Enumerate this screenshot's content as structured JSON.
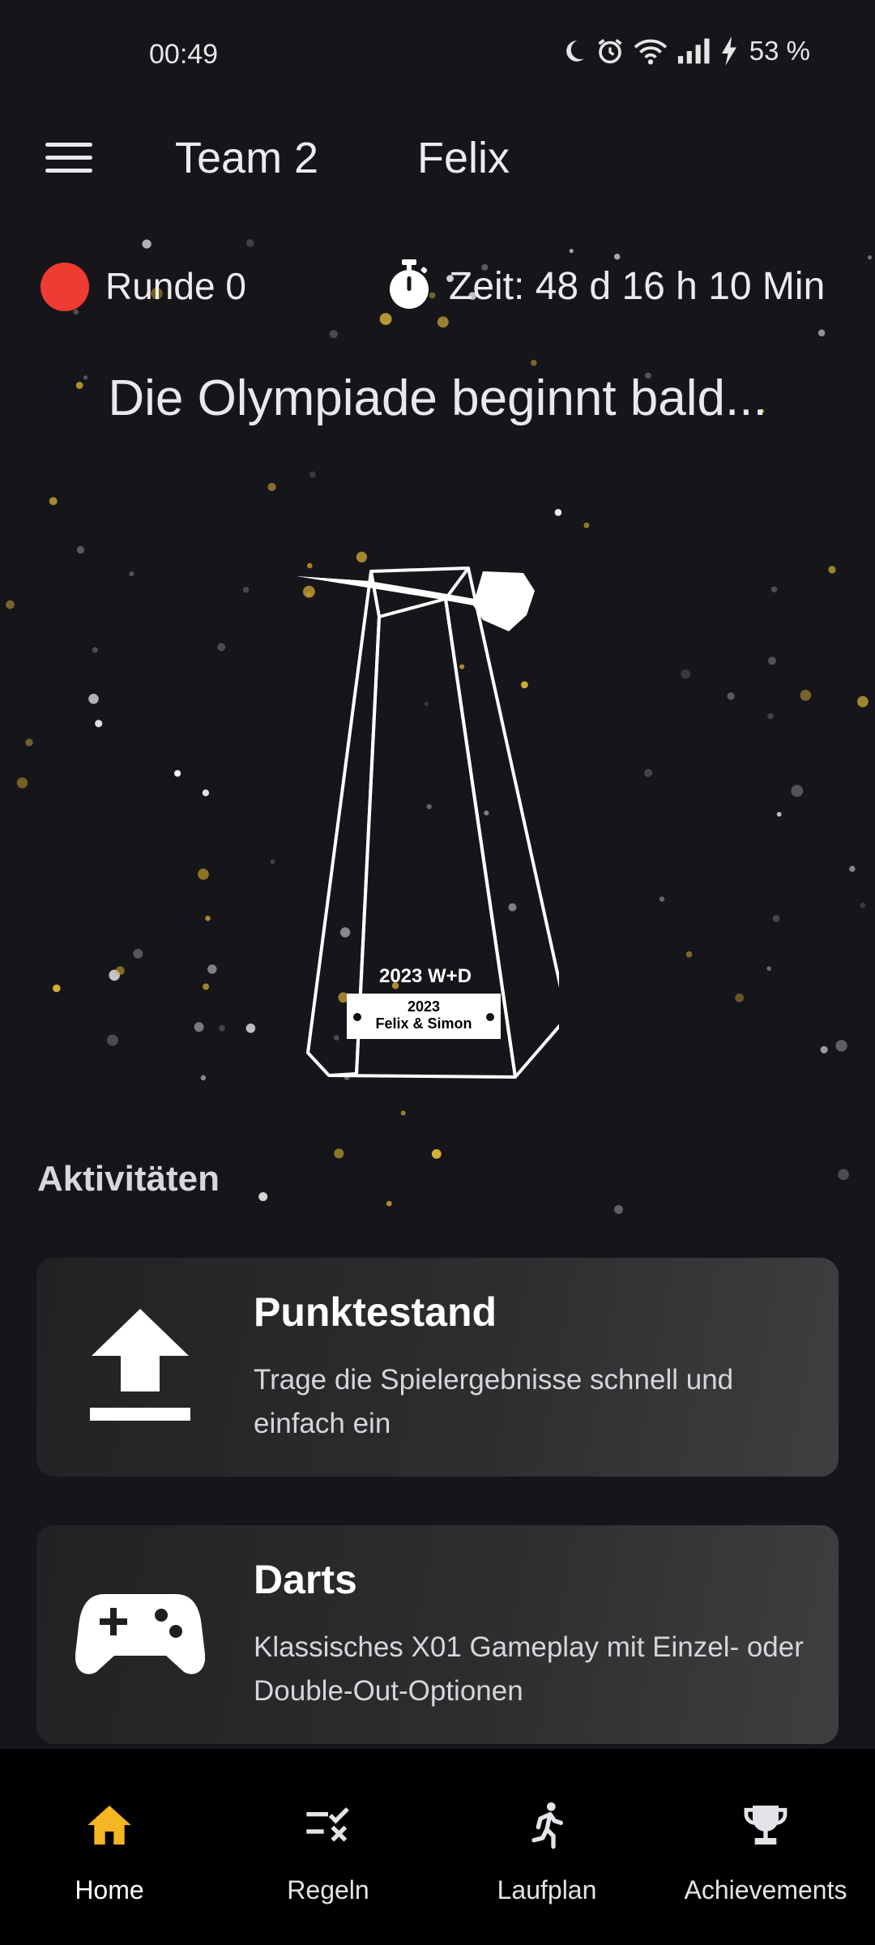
{
  "status_bar": {
    "time": "00:49",
    "battery": "53 %"
  },
  "top_bar": {
    "team": "Team 2",
    "player": "Felix"
  },
  "info": {
    "round": "Runde 0",
    "timer": "Zeit: 48 d 16 h 10 Min"
  },
  "headline": "Die Olympiade beginnt bald...",
  "trophy": {
    "title": "2023 W+D",
    "plaque_line1": "2023",
    "plaque_line2": "Felix & Simon"
  },
  "activities": {
    "title": "Aktivitäten",
    "cards": [
      {
        "icon": "upload-icon",
        "title": "Punktestand",
        "description": "Trage die Spielergebnisse schnell und einfach ein"
      },
      {
        "icon": "gamepad-icon",
        "title": "Darts",
        "description": "Klassisches X01 Gameplay mit Einzel- oder Double-Out-Optionen"
      }
    ]
  },
  "nav": [
    {
      "icon": "home-icon",
      "label": "Home",
      "active": true
    },
    {
      "icon": "rules-icon",
      "label": "Regeln",
      "active": false
    },
    {
      "icon": "runner-icon",
      "label": "Laufplan",
      "active": false
    },
    {
      "icon": "trophy-icon",
      "label": "Achievements",
      "active": false
    }
  ],
  "colors": {
    "background": "#16151a",
    "accent": "#f5b623",
    "round_dot": "#ef3b32",
    "nav_bg": "#000000"
  }
}
